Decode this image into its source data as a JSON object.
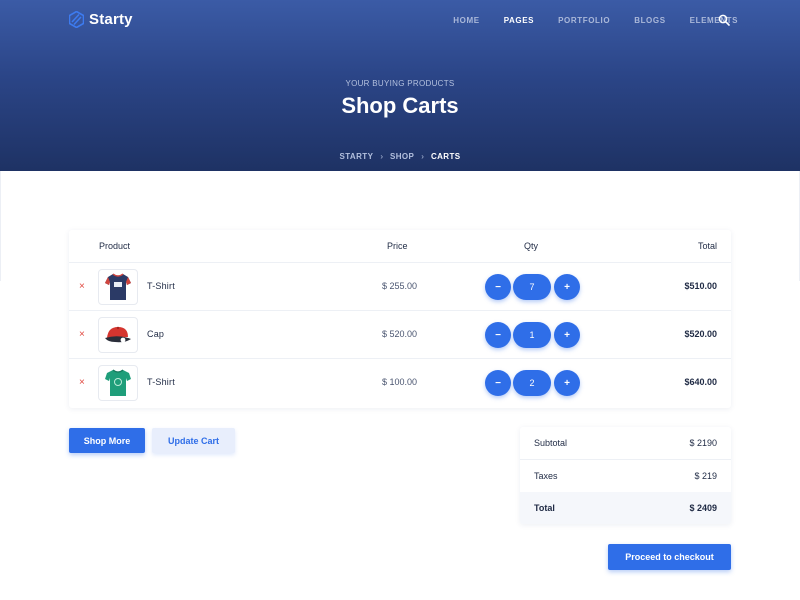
{
  "brand": {
    "name": "Starty"
  },
  "nav": {
    "items": [
      {
        "label": "HOME",
        "active": false
      },
      {
        "label": "PAGES",
        "active": true
      },
      {
        "label": "PORTFOLIO",
        "active": false
      },
      {
        "label": "BLOGS",
        "active": false
      },
      {
        "label": "ELEMENTS",
        "active": false
      }
    ],
    "search_icon": "search-icon"
  },
  "hero": {
    "subtitle": "YOUR BUYING PRODUCTS",
    "title": "Shop Carts",
    "breadcrumb": [
      "STARTY",
      "SHOP",
      "CARTS"
    ]
  },
  "cart": {
    "headers": {
      "product": "Product",
      "price": "Price",
      "qty": "Qty",
      "total": "Total"
    },
    "remove_symbol": "×",
    "minus_symbol": "−",
    "plus_symbol": "+",
    "items": [
      {
        "name": "T-Shirt",
        "price": "$ 255.00",
        "qty": "7",
        "total": "$510.00",
        "image": "navy-tshirt"
      },
      {
        "name": "Cap",
        "price": "$ 520.00",
        "qty": "1",
        "total": "$520.00",
        "image": "red-cap"
      },
      {
        "name": "T-Shirt",
        "price": "$ 100.00",
        "qty": "2",
        "total": "$640.00",
        "image": "green-tshirt"
      }
    ]
  },
  "actions": {
    "shop_more": "Shop More",
    "update_cart": "Update Cart",
    "checkout": "Proceed to checkout"
  },
  "summary": {
    "subtotal_label": "Subtotal",
    "subtotal_value": "$ 2190",
    "taxes_label": "Taxes",
    "taxes_value": "$ 219",
    "total_label": "Total",
    "total_value": "$ 2409"
  },
  "colors": {
    "primary": "#2f6ee8",
    "hero_top": "#3b5ba6",
    "hero_bottom": "#1e3264",
    "remove": "#e0453d"
  }
}
